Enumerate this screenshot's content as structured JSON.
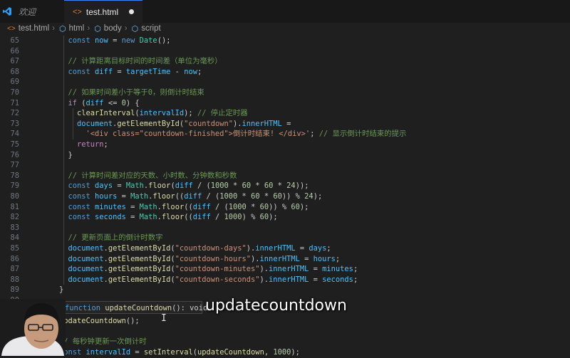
{
  "tabs": [
    {
      "label": "欢迎",
      "icon": "vscode-logo-icon"
    },
    {
      "label": "test.html",
      "icon": "html-file-icon",
      "modified": true
    }
  ],
  "breadcrumb": [
    "test.html",
    "html",
    "body",
    "script"
  ],
  "colors": {
    "accent": "#3b82f6",
    "keyword": "#569cd6",
    "string": "#ce9178",
    "comment": "#6a9955",
    "function": "#dcdcaa"
  },
  "code": {
    "lines": [
      {
        "n": "65",
        "indent": 3,
        "tokens": [
          [
            "kw",
            "const"
          ],
          [
            "",
            " "
          ],
          [
            "vr",
            "now"
          ],
          [
            "",
            " = "
          ],
          [
            "kw",
            "new"
          ],
          [
            "",
            " "
          ],
          [
            "cls",
            "Date"
          ],
          [
            "",
            "();"
          ]
        ]
      },
      {
        "n": "66",
        "indent": 0,
        "tokens": []
      },
      {
        "n": "67",
        "indent": 3,
        "tokens": [
          [
            "cmt",
            "// 计算距离目标时间的时间差（单位为毫秒）"
          ]
        ]
      },
      {
        "n": "68",
        "indent": 3,
        "tokens": [
          [
            "kw",
            "const"
          ],
          [
            "",
            " "
          ],
          [
            "vr",
            "diff"
          ],
          [
            "",
            " = "
          ],
          [
            "vr",
            "targetTime"
          ],
          [
            "",
            " - "
          ],
          [
            "vr",
            "now"
          ],
          [
            "",
            ";"
          ]
        ]
      },
      {
        "n": "69",
        "indent": 0,
        "tokens": []
      },
      {
        "n": "70",
        "indent": 3,
        "tokens": [
          [
            "cmt",
            "// 如果时间差小于等于0，则倒计时结束"
          ]
        ]
      },
      {
        "n": "71",
        "indent": 3,
        "tokens": [
          [
            "ctl",
            "if"
          ],
          [
            "",
            " ("
          ],
          [
            "vr",
            "diff"
          ],
          [
            "",
            " <= "
          ],
          [
            "num",
            "0"
          ],
          [
            "",
            ") {"
          ]
        ]
      },
      {
        "n": "72",
        "indent": 4,
        "tokens": [
          [
            "fn",
            "clearInterval"
          ],
          [
            "",
            "("
          ],
          [
            "vr",
            "intervalId"
          ],
          [
            "",
            "); "
          ],
          [
            "cmt",
            "// 停止定时器"
          ]
        ]
      },
      {
        "n": "73",
        "indent": 4,
        "tokens": [
          [
            "vr",
            "document"
          ],
          [
            "",
            "."
          ],
          [
            "fn",
            "getElementById"
          ],
          [
            "",
            "("
          ],
          [
            "str",
            "\"countdown\""
          ],
          [
            "",
            ")."
          ],
          [
            "vr",
            "innerHTML"
          ],
          [
            "",
            " ="
          ]
        ]
      },
      {
        "n": "74",
        "indent": 5,
        "tokens": [
          [
            "str",
            "'<div class=\"countdown-finished\">倒计时结束! </div>'"
          ],
          [
            "",
            "; "
          ],
          [
            "cmt",
            "// 显示倒计时结束的提示"
          ]
        ]
      },
      {
        "n": "75",
        "indent": 4,
        "tokens": [
          [
            "ctl",
            "return"
          ],
          [
            "",
            ";"
          ]
        ]
      },
      {
        "n": "76",
        "indent": 3,
        "tokens": [
          [
            "",
            "}"
          ]
        ]
      },
      {
        "n": "77",
        "indent": 0,
        "tokens": []
      },
      {
        "n": "78",
        "indent": 3,
        "tokens": [
          [
            "cmt",
            "// 计算时间差对应的天数、小时数、分钟数和秒数"
          ]
        ]
      },
      {
        "n": "79",
        "indent": 3,
        "tokens": [
          [
            "kw",
            "const"
          ],
          [
            "",
            " "
          ],
          [
            "vr",
            "days"
          ],
          [
            "",
            " = "
          ],
          [
            "cls",
            "Math"
          ],
          [
            "",
            "."
          ],
          [
            "fn",
            "floor"
          ],
          [
            "",
            "("
          ],
          [
            "vr",
            "diff"
          ],
          [
            "",
            " / ("
          ],
          [
            "num",
            "1000"
          ],
          [
            "",
            " * "
          ],
          [
            "num",
            "60"
          ],
          [
            "",
            " * "
          ],
          [
            "num",
            "60"
          ],
          [
            "",
            " * "
          ],
          [
            "num",
            "24"
          ],
          [
            "",
            "));"
          ]
        ]
      },
      {
        "n": "80",
        "indent": 3,
        "tokens": [
          [
            "kw",
            "const"
          ],
          [
            "",
            " "
          ],
          [
            "vr",
            "hours"
          ],
          [
            "",
            " = "
          ],
          [
            "cls",
            "Math"
          ],
          [
            "",
            "."
          ],
          [
            "fn",
            "floor"
          ],
          [
            "",
            "(("
          ],
          [
            "vr",
            "diff"
          ],
          [
            "",
            " / ("
          ],
          [
            "num",
            "1000"
          ],
          [
            "",
            " * "
          ],
          [
            "num",
            "60"
          ],
          [
            "",
            " * "
          ],
          [
            "num",
            "60"
          ],
          [
            "",
            ")) % "
          ],
          [
            "num",
            "24"
          ],
          [
            "",
            ");"
          ]
        ]
      },
      {
        "n": "81",
        "indent": 3,
        "tokens": [
          [
            "kw",
            "const"
          ],
          [
            "",
            " "
          ],
          [
            "vr",
            "minutes"
          ],
          [
            "",
            " = "
          ],
          [
            "cls",
            "Math"
          ],
          [
            "",
            "."
          ],
          [
            "fn",
            "floor"
          ],
          [
            "",
            "(("
          ],
          [
            "vr",
            "diff"
          ],
          [
            "",
            " / ("
          ],
          [
            "num",
            "1000"
          ],
          [
            "",
            " * "
          ],
          [
            "num",
            "60"
          ],
          [
            "",
            ")) % "
          ],
          [
            "num",
            "60"
          ],
          [
            "",
            ");"
          ]
        ]
      },
      {
        "n": "82",
        "indent": 3,
        "tokens": [
          [
            "kw",
            "const"
          ],
          [
            "",
            " "
          ],
          [
            "vr",
            "seconds"
          ],
          [
            "",
            " = "
          ],
          [
            "cls",
            "Math"
          ],
          [
            "",
            "."
          ],
          [
            "fn",
            "floor"
          ],
          [
            "",
            "(("
          ],
          [
            "vr",
            "diff"
          ],
          [
            "",
            " / "
          ],
          [
            "num",
            "1000"
          ],
          [
            "",
            ") % "
          ],
          [
            "num",
            "60"
          ],
          [
            "",
            ");"
          ]
        ]
      },
      {
        "n": "83",
        "indent": 0,
        "tokens": []
      },
      {
        "n": "84",
        "indent": 3,
        "tokens": [
          [
            "cmt",
            "// 更新页面上的倒计时数字"
          ]
        ]
      },
      {
        "n": "85",
        "indent": 3,
        "tokens": [
          [
            "vr",
            "document"
          ],
          [
            "",
            "."
          ],
          [
            "fn",
            "getElementById"
          ],
          [
            "",
            "("
          ],
          [
            "str",
            "\"countdown-days\""
          ],
          [
            "",
            ")."
          ],
          [
            "vr",
            "innerHTML"
          ],
          [
            "",
            " = "
          ],
          [
            "vr",
            "days"
          ],
          [
            "",
            ";"
          ]
        ]
      },
      {
        "n": "86",
        "indent": 3,
        "tokens": [
          [
            "vr",
            "document"
          ],
          [
            "",
            "."
          ],
          [
            "fn",
            "getElementById"
          ],
          [
            "",
            "("
          ],
          [
            "str",
            "\"countdown-hours\""
          ],
          [
            "",
            ")."
          ],
          [
            "vr",
            "innerHTML"
          ],
          [
            "",
            " = "
          ],
          [
            "vr",
            "hours"
          ],
          [
            "",
            ";"
          ]
        ]
      },
      {
        "n": "87",
        "indent": 3,
        "tokens": [
          [
            "vr",
            "document"
          ],
          [
            "",
            "."
          ],
          [
            "fn",
            "getElementById"
          ],
          [
            "",
            "("
          ],
          [
            "str",
            "\"countdown-minutes\""
          ],
          [
            "",
            ")."
          ],
          [
            "vr",
            "innerHTML"
          ],
          [
            "",
            " = "
          ],
          [
            "vr",
            "minutes"
          ],
          [
            "",
            ";"
          ]
        ]
      },
      {
        "n": "88",
        "indent": 3,
        "tokens": [
          [
            "vr",
            "document"
          ],
          [
            "",
            "."
          ],
          [
            "fn",
            "getElementById"
          ],
          [
            "",
            "("
          ],
          [
            "str",
            "\"countdown-seconds\""
          ],
          [
            "",
            ")."
          ],
          [
            "vr",
            "innerHTML"
          ],
          [
            "",
            " = "
          ],
          [
            "vr",
            "seconds"
          ],
          [
            "",
            ";"
          ]
        ]
      },
      {
        "n": "89",
        "indent": 2,
        "tokens": [
          [
            "",
            "}"
          ]
        ]
      },
      {
        "n": "90",
        "indent": 0,
        "tokens": []
      },
      {
        "n": "91",
        "indent": 0,
        "tokens": [],
        "current": true
      },
      {
        "n": "92",
        "indent": 2,
        "tokens": [
          [
            "fn",
            "updateCountdown"
          ],
          [
            "",
            "();"
          ]
        ]
      },
      {
        "n": "93",
        "indent": 0,
        "tokens": []
      },
      {
        "n": "94",
        "indent": 2,
        "tokens": [
          [
            "cmt",
            "// 每秒钟更新一次倒计时"
          ]
        ]
      },
      {
        "n": "95",
        "indent": 2,
        "tokens": [
          [
            "kw",
            "const"
          ],
          [
            "",
            " "
          ],
          [
            "vr",
            "intervalId"
          ],
          [
            "",
            " = "
          ],
          [
            "fn",
            "setInterval"
          ],
          [
            "",
            "("
          ],
          [
            "fn",
            "updateCountdown"
          ],
          [
            "",
            ", "
          ],
          [
            "num",
            "1000"
          ],
          [
            "",
            ");"
          ]
        ]
      }
    ]
  },
  "hover": {
    "keyword": "function",
    "name": "updateCountdown",
    "signature": "(): void"
  },
  "caption": "updatecountdown"
}
